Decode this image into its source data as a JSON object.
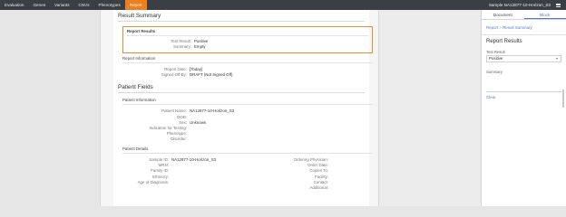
{
  "nav": {
    "tabs": [
      "Evaluation",
      "Genes",
      "Variants",
      "CNVs",
      "Phenotypes",
      "Report"
    ],
    "active_tab": "Report",
    "sample_title": "Sample NA12877-10-Horizon_S3"
  },
  "report_summary": {
    "title": "Result Summary",
    "report_results": {
      "title": "Report Results",
      "test_result_label": "Test Result:",
      "test_result_value": "Positive",
      "summary_label": "Summary:",
      "summary_value": "Empty"
    },
    "report_information": {
      "title": "Report Information",
      "report_date_label": "Report Date:",
      "report_date_value": "[Today]",
      "signed_off_label": "Signed Off By:",
      "signed_off_value": "DRAFT (Not Signed Off)"
    }
  },
  "patient_fields": {
    "title": "Patient Fields",
    "patient_information": {
      "title": "Patient Information",
      "rows": [
        {
          "label": "Patient Name:",
          "value": "NA12877-10-Horizon_S3"
        },
        {
          "label": "DOB:",
          "value": ""
        },
        {
          "label": "Sex:",
          "value": "Unknown"
        },
        {
          "label": "Indication for Testing:",
          "value": ""
        },
        {
          "label": "Phenotype:",
          "value": ""
        },
        {
          "label": "Disorder:",
          "value": ""
        }
      ]
    },
    "patient_details": {
      "title": "Patient Details",
      "left": [
        {
          "label": "Sample ID:",
          "value": "NA12877-10-Horizon_S3"
        },
        {
          "label": "MRN:",
          "value": ""
        },
        {
          "label": "Family ID:",
          "value": ""
        },
        {
          "label": "Ethnicity:",
          "value": ""
        },
        {
          "label": "Age of Diagnosis:",
          "value": ""
        }
      ],
      "right": [
        {
          "label": "Ordering Physician:",
          "value": ""
        },
        {
          "label": "Order Date:",
          "value": ""
        },
        {
          "label": "Copies To:",
          "value": ""
        },
        {
          "label": "Facility:",
          "value": ""
        },
        {
          "label": "Contact:",
          "value": ""
        },
        {
          "label": "Additional:",
          "value": ""
        }
      ]
    }
  },
  "sidebar": {
    "tabs": [
      "Document",
      "Block"
    ],
    "active_tab": "Block",
    "breadcrumb": [
      "Report",
      "Result Summary"
    ],
    "breadcrumb_sep": ">",
    "section_title": "Report Results",
    "test_result_label": "Test Result",
    "test_result_value": "Positive",
    "summary_label": "Summary",
    "clear_label": "Clear"
  },
  "colors": {
    "accent": "#ee7f1e",
    "link": "#4c7bc6",
    "topbar": "#3b3f45"
  }
}
